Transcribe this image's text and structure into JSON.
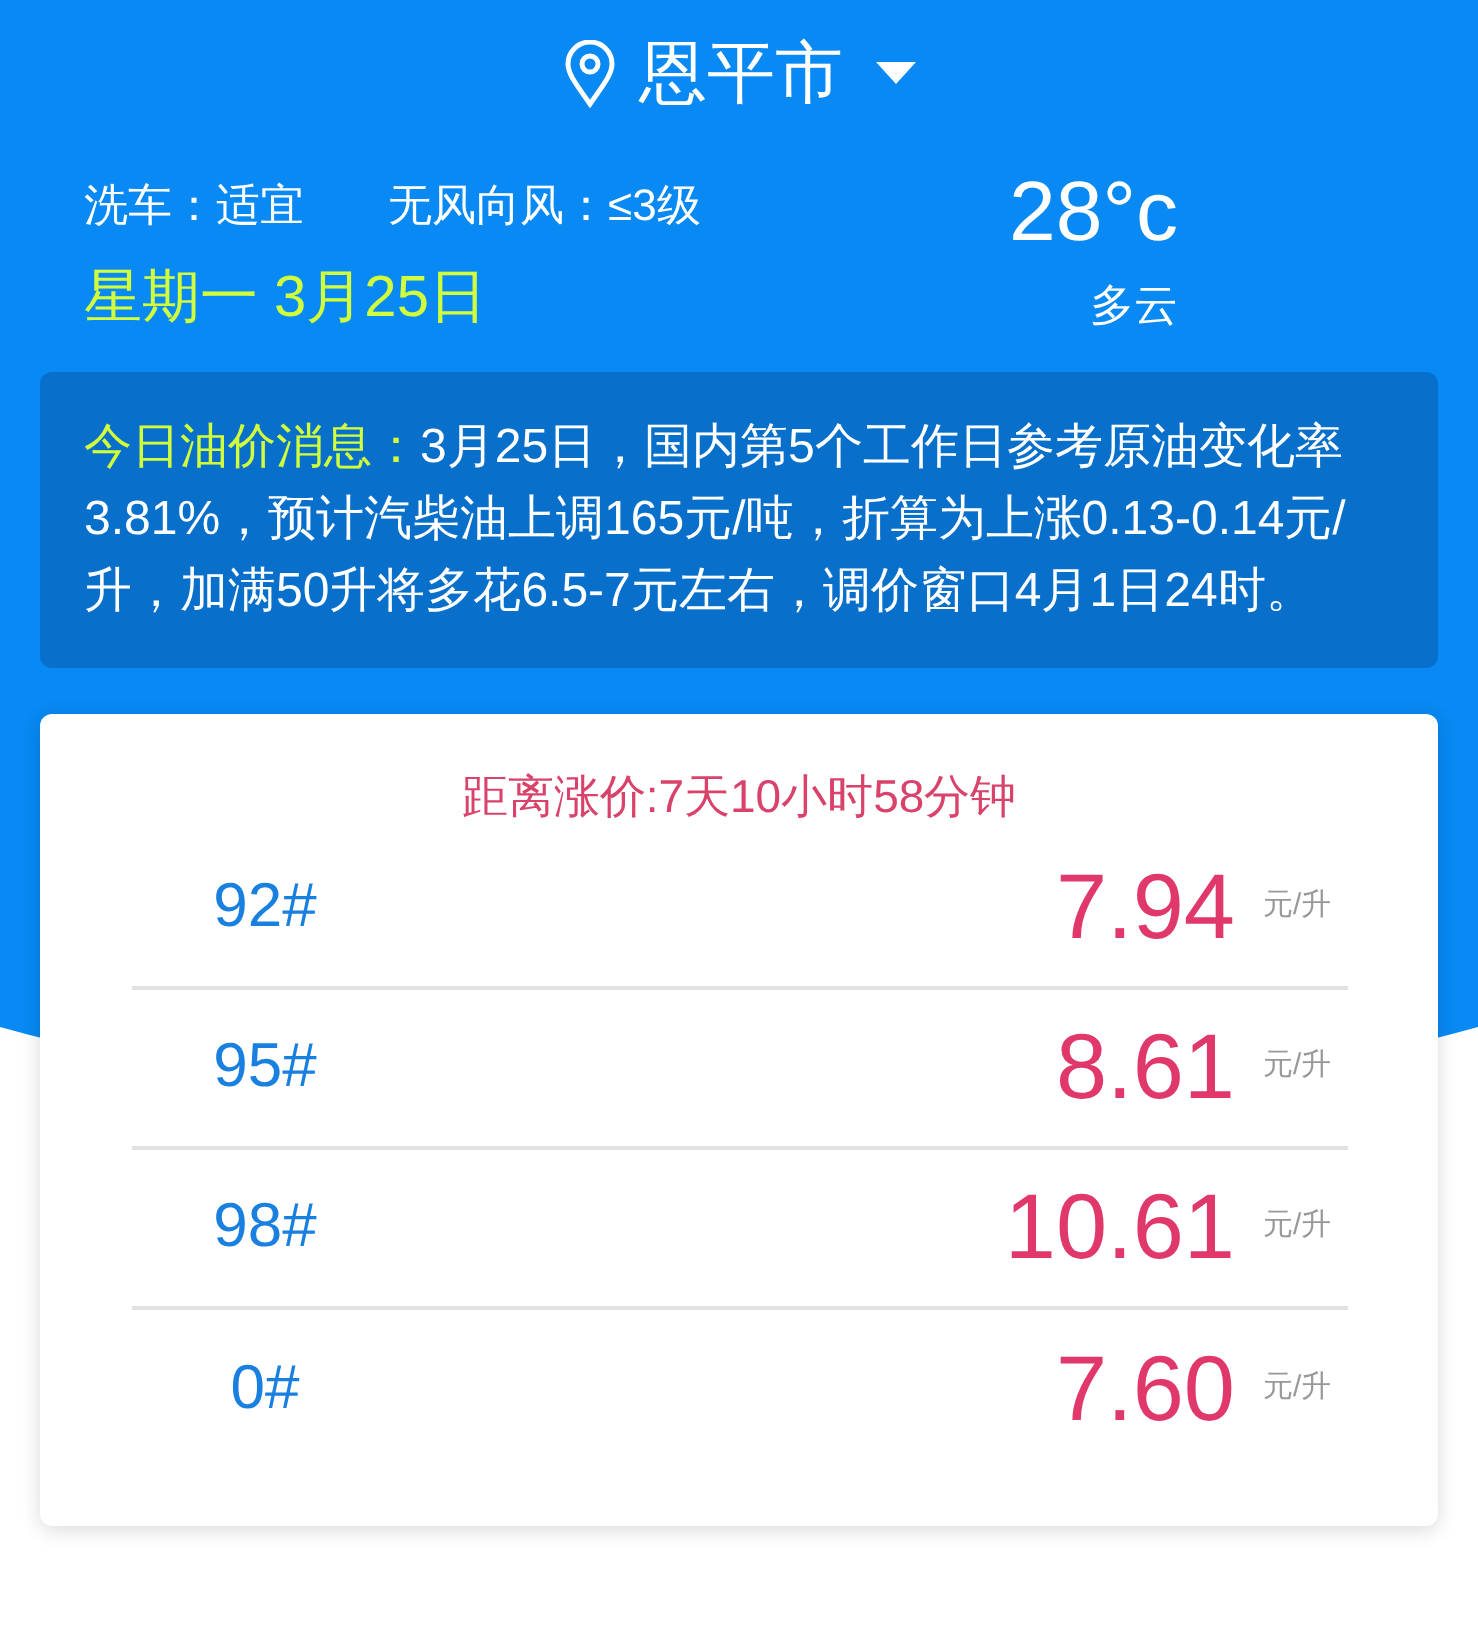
{
  "location": {
    "city": "恩平市"
  },
  "weather": {
    "car_wash": "洗车：适宜",
    "wind": "无风向风：≤3级",
    "temperature": "28°c",
    "date": "星期一 3月25日",
    "condition": "多云"
  },
  "notice": {
    "label": "今日油价消息：",
    "text": "3月25日，国内第5个工作日参考原油变化率3.81%，预计汽柴油上调165元/吨，折算为上涨0.13-0.14元/升，加满50升将多花6.5-7元左右，调价窗口4月1日24时。"
  },
  "prices": {
    "countdown": "距离涨价:7天10小时58分钟",
    "rows": [
      {
        "grade": "92#",
        "price": "7.94",
        "unit": "元/升"
      },
      {
        "grade": "95#",
        "price": "8.61",
        "unit": "元/升"
      },
      {
        "grade": "98#",
        "price": "10.61",
        "unit": "元/升"
      },
      {
        "grade": "0#",
        "price": "7.60",
        "unit": "元/升"
      }
    ]
  }
}
